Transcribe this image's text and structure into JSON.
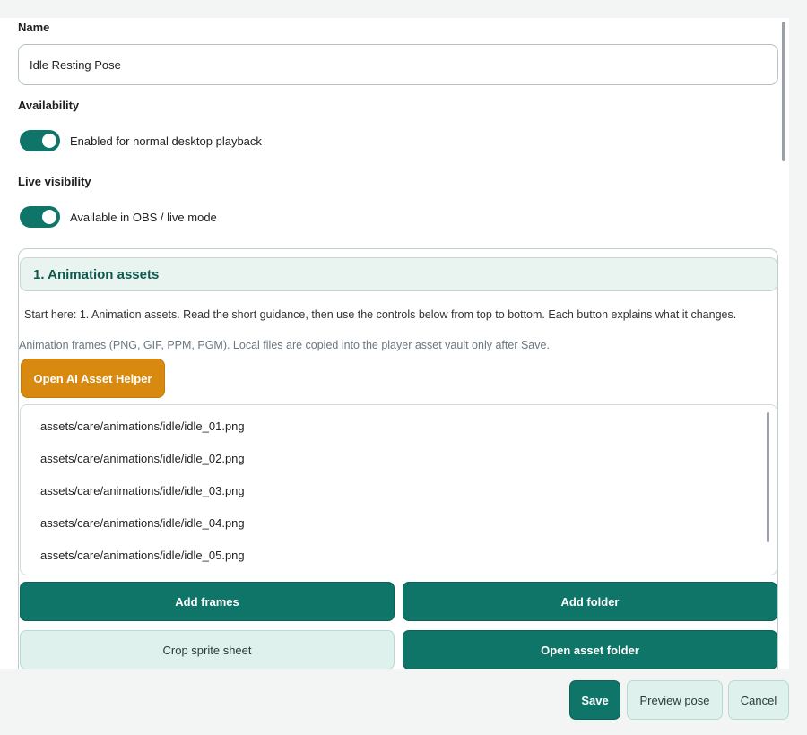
{
  "name": {
    "label": "Name",
    "value": "Idle Resting Pose"
  },
  "availability": {
    "label": "Availability",
    "toggle_text": "Enabled for normal desktop playback",
    "enabled": true
  },
  "live_visibility": {
    "label": "Live visibility",
    "toggle_text": "Available in OBS / live mode",
    "enabled": true
  },
  "section": {
    "title": "1. Animation assets",
    "guidance": "Start here: 1. Animation assets. Read the short guidance, then use the controls below from top to bottom. Each button explains what it changes.",
    "hint": "Animation frames (PNG, GIF, PPM, PGM). Local files are copied into the player asset vault only after Save.",
    "ai_helper_label": "Open AI Asset Helper",
    "frames": [
      "assets/care/animations/idle/idle_01.png",
      "assets/care/animations/idle/idle_02.png",
      "assets/care/animations/idle/idle_03.png",
      "assets/care/animations/idle/idle_04.png",
      "assets/care/animations/idle/idle_05.png"
    ],
    "add_frames_label": "Add frames",
    "add_folder_label": "Add folder",
    "crop_label": "Crop sprite sheet",
    "open_folder_label": "Open asset folder"
  },
  "footer": {
    "save_label": "Save",
    "preview_label": "Preview pose",
    "cancel_label": "Cancel"
  },
  "colors": {
    "accent": "#0f7568",
    "ai_button": "#d88a10",
    "secondary_button": "#dff1ec",
    "section_header_bg": "#e9f3ef"
  }
}
